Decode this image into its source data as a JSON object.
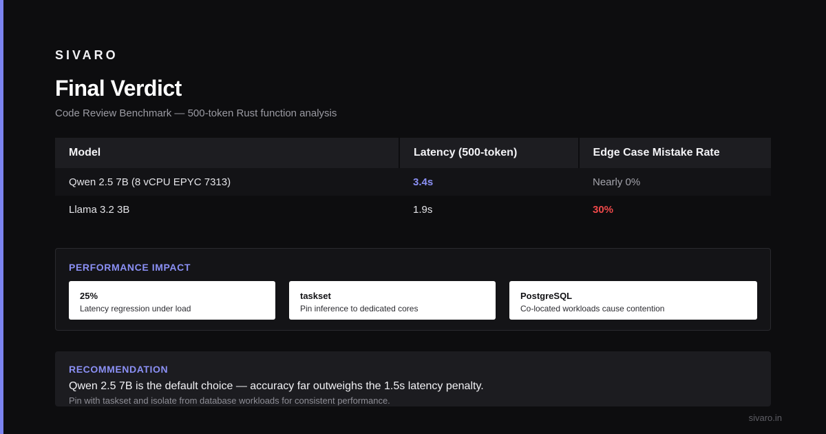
{
  "brand": "SIVARO",
  "title": "Final Verdict",
  "subtitle": "Code Review Benchmark — 500-token Rust function analysis",
  "table": {
    "headers": [
      "Model",
      "Latency (500-token)",
      "Edge Case Mistake Rate"
    ],
    "rows": [
      [
        "Qwen 2.5 7B (8 vCPU EPYC 7313)",
        "3.4s",
        "Nearly 0%"
      ],
      [
        "Llama 3.2 3B",
        "1.9s",
        "30%"
      ]
    ]
  },
  "impact": {
    "label": "PERFORMANCE IMPACT",
    "cards": [
      {
        "value": "25%",
        "desc": "Latency regression under load"
      },
      {
        "value": "taskset",
        "desc": "Pin inference to dedicated cores"
      },
      {
        "value": "PostgreSQL",
        "desc": "Co-located workloads cause contention"
      }
    ]
  },
  "recommendation": {
    "label": "RECOMMENDATION",
    "main": "Qwen 2.5 7B is the default choice — accuracy far outweighs the 1.5s latency penalty.",
    "sub": "Pin with taskset and isolate from database workloads for consistent performance."
  },
  "footer": "sivaro.in",
  "colors": {
    "accent": "#7b83f0",
    "highlight": "#8b90f5",
    "danger": "#f0494a",
    "background": "#0d0d0f"
  }
}
